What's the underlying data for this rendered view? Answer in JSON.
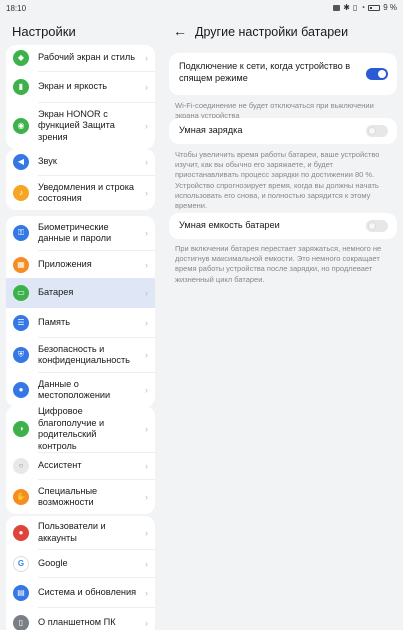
{
  "status_bar": {
    "time": "18:10",
    "battery_percent": "9 %"
  },
  "left_panel": {
    "title": "Настройки",
    "groups": [
      {
        "items": [
          {
            "label": "Рабочий экран и стиль",
            "icon": "home-style-icon",
            "color": "#3db24a"
          },
          {
            "label": "Экран и яркость",
            "icon": "display-icon",
            "color": "#3db24a"
          },
          {
            "label": "Экран HONOR с функцией Защита зрения",
            "icon": "eye-protection-icon",
            "color": "#3db24a"
          }
        ]
      },
      {
        "items": [
          {
            "label": "Звук",
            "icon": "sound-icon",
            "color": "#3578e5"
          },
          {
            "label": "Уведомления и строка состояния",
            "icon": "notification-bell-icon",
            "color": "#f5a623"
          }
        ]
      },
      {
        "items": [
          {
            "label": "Биометрические данные и пароли",
            "icon": "key-icon",
            "color": "#3578e5"
          },
          {
            "label": "Приложения",
            "icon": "apps-grid-icon",
            "color": "#f58d22"
          },
          {
            "label": "Батарея",
            "icon": "battery-icon",
            "color": "#3db24a",
            "active": true
          },
          {
            "label": "Память",
            "icon": "storage-icon",
            "color": "#3578e5"
          },
          {
            "label": "Безопасность и конфиденциальность",
            "icon": "shield-icon",
            "color": "#3578e5"
          },
          {
            "label": "Данные о местоположении",
            "icon": "location-pin-icon",
            "color": "#3578e5"
          }
        ]
      },
      {
        "items": [
          {
            "label": "Цифровое благополучие и родительский контроль",
            "icon": "wellbeing-icon",
            "color": "#3db24a"
          },
          {
            "label": "Ассистент",
            "icon": "assistant-icon",
            "color": "#e8e8e8"
          },
          {
            "label": "Специальные возможности",
            "icon": "accessibility-hand-icon",
            "color": "#f58d22"
          }
        ]
      },
      {
        "items": [
          {
            "label": "Пользователи и аккаунты",
            "icon": "user-icon",
            "color": "#e0433a"
          },
          {
            "label": "Google",
            "icon": "google-icon",
            "color": "#ffffff"
          },
          {
            "label": "Система и обновления",
            "icon": "system-update-icon",
            "color": "#3578e5"
          },
          {
            "label": "О планшетном ПК",
            "icon": "tablet-info-icon",
            "color": "#7a7f87"
          }
        ]
      }
    ]
  },
  "right_panel": {
    "title": "Другие настройки батареи",
    "settings": [
      {
        "label": "Подключение к сети, когда устройство в спящем режиме",
        "enabled": true,
        "description": "Wi-Fi-соединение не будет отключаться при выключении экрана устройства"
      },
      {
        "label": "Умная зарядка",
        "enabled": false,
        "description": "Чтобы увеличить время работы батареи, ваше устройство изучит, как вы обычно его заряжаете, и будет приостанавливать процесс зарядки по достижении 80 %. Устройство спрогнозирует время, когда вы должны начать использовать его снова, и полностью зарядится к этому времени."
      },
      {
        "label": "Умная емкость батареи",
        "enabled": false,
        "description": "При включении батарея перестает заряжаться, немного не достигнув максимальной емкости. Это немного сокращает время работы устройства после зарядки, но продлевает жизненный цикл батареи."
      }
    ]
  },
  "colors": {
    "accent": "#2a5bd7",
    "active_item_bg": "#dfe7f7",
    "background": "#f1f3f5"
  }
}
